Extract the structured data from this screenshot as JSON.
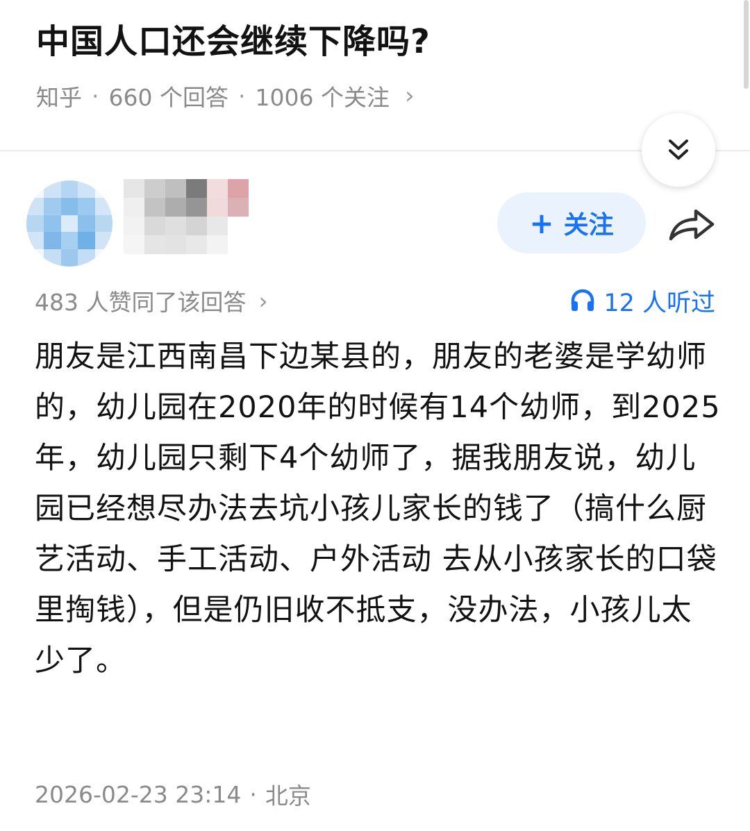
{
  "question": {
    "title": "中国人口还会继续下降吗?",
    "source": "知乎",
    "answers_count": "660 个回答",
    "followers_count": "1006 个关注",
    "separator": "·",
    "chevron": "›"
  },
  "author": {
    "follow_label": "关注",
    "follow_plus": "+"
  },
  "stats": {
    "likes_text": "483 人赞同了该回答",
    "chevron": "›",
    "listen_text": "12 人听过"
  },
  "answer": {
    "body": "朋友是江西南昌下边某县的，朋友的老婆是学幼师的，幼儿园在2020年的时候有14个幼师，到2025年，幼儿园只剩下4个幼师了，据我朋友说，幼儿园已经想尽办法去坑小孩儿家长的钱了（搞什么厨艺活动、手工活动、户外活动 去从小孩家长的口袋里掏钱），但是仍旧收不抵支，没办法，小孩儿太少了。",
    "timestamp": "2026-02-23 23:14",
    "separator": "·",
    "location": "北京"
  },
  "icons": [
    "collapse-double-chevron-icon",
    "share-arrow-icon",
    "headphones-icon",
    "chevron-right-icon"
  ],
  "colors": {
    "accent": "#1772f6",
    "follow_bg": "#eaf2fd",
    "text_primary": "#121212",
    "text_secondary": "#8a8a8a"
  }
}
